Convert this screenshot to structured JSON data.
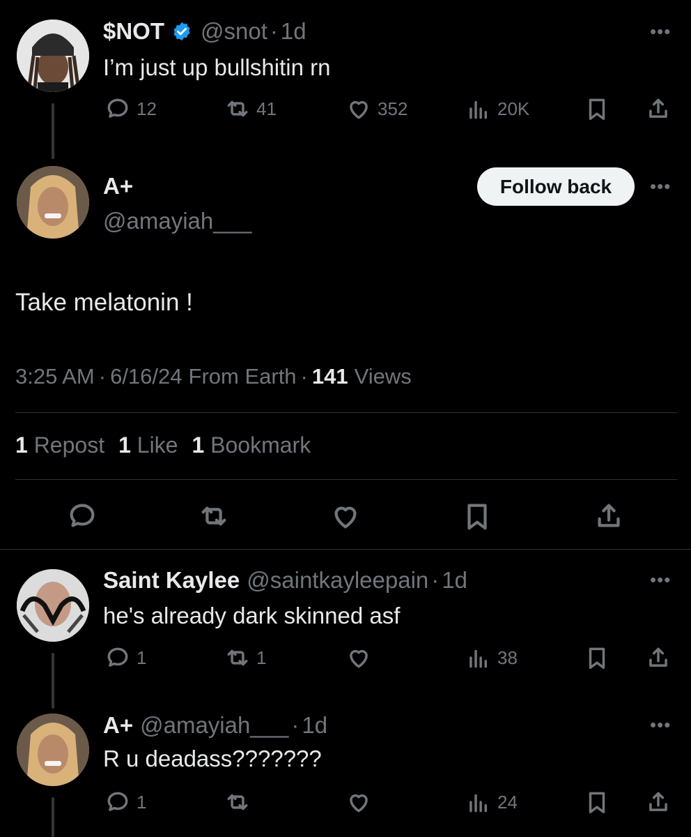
{
  "tweet1": {
    "name": "$NOT",
    "handle": "@snot",
    "time": "1d",
    "text": "I’m just up bullshitin rn",
    "replies": "12",
    "reposts": "41",
    "likes": "352",
    "views": "20K"
  },
  "main": {
    "name": "A+",
    "handle": "@amayiah___",
    "follow_label": "Follow back",
    "text": "Take melatonin !",
    "time": "3:25 AM",
    "date": "6/16/24",
    "source": "From Earth",
    "views_count": "141",
    "views_label": "Views",
    "reposts_count": "1",
    "reposts_label": "Repost",
    "likes_count": "1",
    "likes_label": "Like",
    "bookmarks_count": "1",
    "bookmarks_label": "Bookmark"
  },
  "reply1": {
    "name": "Saint Kaylee",
    "handle": "@saintkayleepain",
    "time": "1d",
    "text": "he's already dark skinned asf",
    "replies": "1",
    "reposts": "1",
    "views": "38"
  },
  "reply2": {
    "name": "A+",
    "handle": "@amayiah___",
    "time": "1d",
    "text": "R u deadass???????",
    "replies": "1",
    "views": "24"
  },
  "ui": {
    "dot": "·",
    "more": "•••"
  },
  "colors": {
    "background": "#000000",
    "text": "#e7e9ea",
    "muted": "#71767b",
    "verified": "#1d9bf0",
    "divider": "#2f3336"
  }
}
